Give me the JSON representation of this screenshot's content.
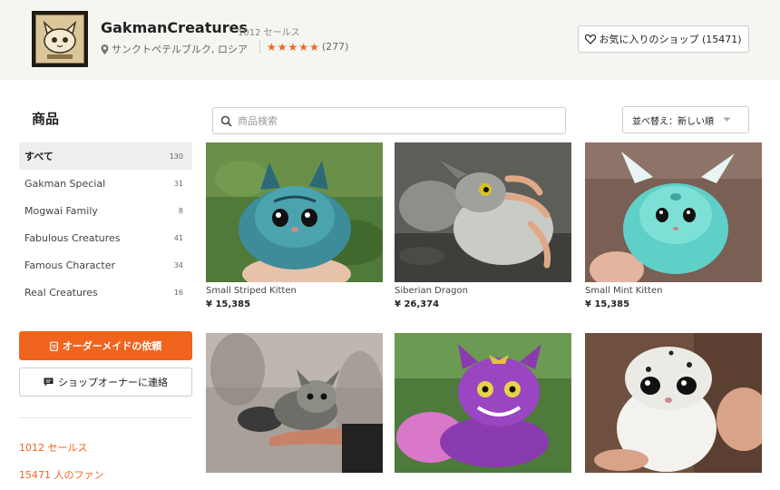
{
  "shop": {
    "name": "GakmanCreatures",
    "sales": "1012 セールス",
    "location": "サンクトペテルブルク, ロシア",
    "review_count": "(277)",
    "favorite_label": "お気に入りのショップ (15471)"
  },
  "sidebar": {
    "title": "商品",
    "categories": [
      {
        "label": "すべて",
        "count": "130"
      },
      {
        "label": "Gakman Special",
        "count": "31"
      },
      {
        "label": "Mogwai Family",
        "count": "8"
      },
      {
        "label": "Fabulous Creatures",
        "count": "41"
      },
      {
        "label": "Famous Character",
        "count": "34"
      },
      {
        "label": "Real Creatures",
        "count": "16"
      }
    ],
    "order_button": "オーダーメイドの依頼",
    "contact_button": "ショップオーナーに連絡",
    "stats_sales": "1012 セールス",
    "stats_fans": "15471 人のファン"
  },
  "toolbar": {
    "search_placeholder": "商品検索",
    "sort_label": "並べ替え：新しい順"
  },
  "products": [
    {
      "title": "Small Striped Kitten",
      "price": "¥ 15,385"
    },
    {
      "title": "Siberian Dragon",
      "price": "¥ 26,374"
    },
    {
      "title": "Small Mint Kitten",
      "price": "¥ 15,385"
    },
    {
      "title": "",
      "price": ""
    },
    {
      "title": "",
      "price": ""
    },
    {
      "title": "",
      "price": ""
    }
  ],
  "colors": {
    "accent": "#f1641e",
    "header_bg": "#f5f5f1",
    "active_category_bg": "#eeeeee"
  },
  "icons": {
    "location": "location-pin-icon",
    "star": "star-icon",
    "heart": "heart-icon",
    "search": "search-icon",
    "dropdown": "chevron-down-icon",
    "order": "clipboard-icon",
    "contact": "message-icon"
  }
}
